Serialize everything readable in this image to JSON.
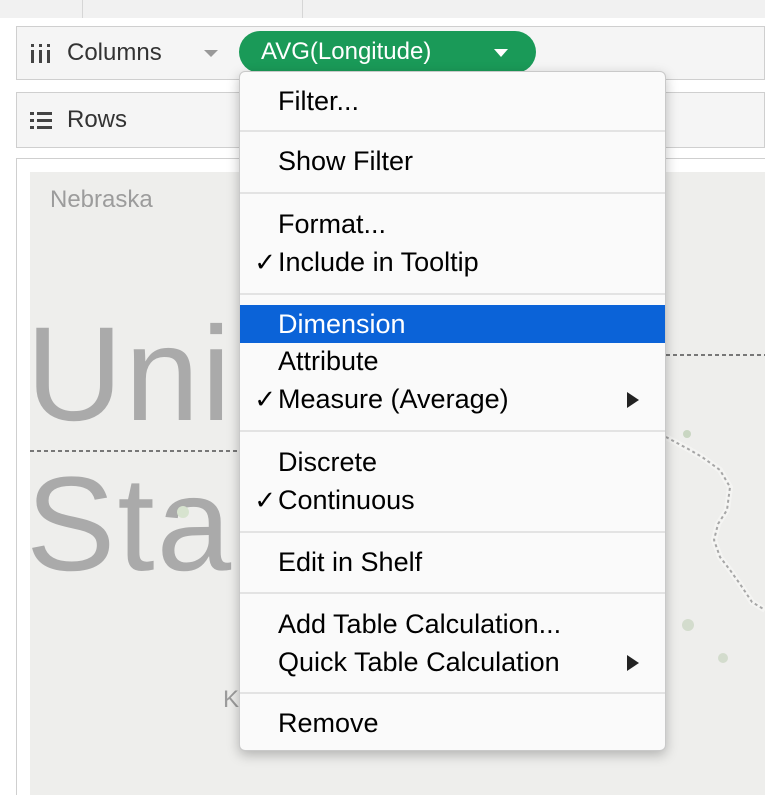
{
  "shelves": {
    "columns_label": "Columns",
    "rows_label": "Rows",
    "pill_label": "AVG(Longitude)"
  },
  "map": {
    "state_label": "Nebraska",
    "partial_label": "K",
    "big_line1": "Uni",
    "big_line2": "Sta"
  },
  "menu": {
    "filter": "Filter...",
    "show_filter": "Show Filter",
    "format": "Format...",
    "include_tooltip": "Include in Tooltip",
    "dimension": "Dimension",
    "attribute": "Attribute",
    "measure": "Measure (Average)",
    "discrete": "Discrete",
    "continuous": "Continuous",
    "edit_in_shelf": "Edit in Shelf",
    "add_table_calc": "Add Table Calculation...",
    "quick_table_calc": "Quick Table Calculation",
    "remove": "Remove",
    "check_mark": "✓"
  },
  "colors": {
    "pill": "#1a9a58",
    "selection": "#0b63d8",
    "map_bg": "#eeeeec"
  }
}
